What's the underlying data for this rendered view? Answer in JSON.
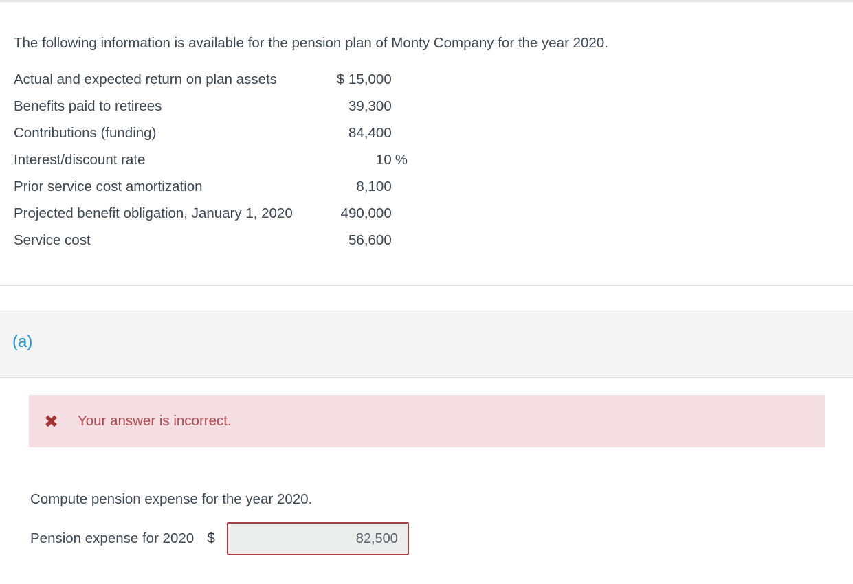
{
  "intro": {
    "text": "The following information is available for the pension plan of Monty Company for the year 2020."
  },
  "facts_table": {
    "rows": [
      {
        "label": "Actual and expected return on plan assets",
        "value": "$ 15,000",
        "unit": ""
      },
      {
        "label": "Benefits paid to retirees",
        "value": "39,300",
        "unit": ""
      },
      {
        "label": "Contributions (funding)",
        "value": "84,400",
        "unit": ""
      },
      {
        "label": "Interest/discount rate",
        "value": "10",
        "unit": "%"
      },
      {
        "label": "Prior service cost amortization",
        "value": "8,100",
        "unit": ""
      },
      {
        "label": "Projected benefit obligation, January 1, 2020",
        "value": "490,000",
        "unit": ""
      },
      {
        "label": "Service cost",
        "value": "56,600",
        "unit": ""
      }
    ]
  },
  "part": {
    "label": "(a)",
    "color": "#1b94d4"
  },
  "alert": {
    "icon": "✖",
    "icon_name": "cross-mark-icon",
    "message": "Your answer is incorrect.",
    "background_color": "#f5dfe2",
    "text_color": "#b0484f",
    "icon_color": "#a63232"
  },
  "prompt": {
    "text": "Compute pension expense for the year 2020."
  },
  "answer": {
    "label": "Pension expense for 2020",
    "currency_symbol": "$",
    "value": "82,500",
    "placeholder": "",
    "border_color": "#a14343",
    "field_background": "#eceded"
  }
}
